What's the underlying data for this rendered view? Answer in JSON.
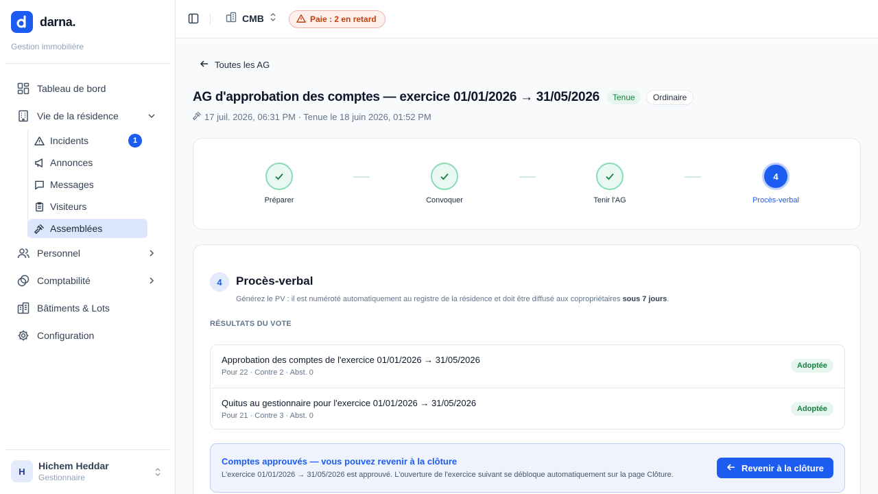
{
  "brand": {
    "name": "darna.",
    "subtitle": "Gestion immobilière",
    "accent": "#1d5cf0"
  },
  "sidebar": {
    "items": [
      {
        "label": "Tableau de bord",
        "icon": "dashboard-icon"
      },
      {
        "label": "Vie de la résidence",
        "icon": "building-icon",
        "expanded": true
      },
      {
        "label": "Personnel",
        "icon": "users-icon"
      },
      {
        "label": "Comptabilité",
        "icon": "coins-icon"
      },
      {
        "label": "Bâtiments & Lots",
        "icon": "buildings-icon"
      },
      {
        "label": "Configuration",
        "icon": "gear-icon"
      }
    ],
    "subitems": [
      {
        "label": "Incidents",
        "icon": "warning-icon",
        "badge": "1"
      },
      {
        "label": "Annonces",
        "icon": "megaphone-icon"
      },
      {
        "label": "Messages",
        "icon": "message-icon"
      },
      {
        "label": "Visiteurs",
        "icon": "clipboard-icon"
      },
      {
        "label": "Assemblées",
        "icon": "gavel-icon",
        "active": true
      }
    ]
  },
  "user": {
    "initial": "H",
    "name": "Hichem Heddar",
    "role": "Gestionnaire"
  },
  "topbar": {
    "site": "CMB",
    "alert": "Paie : 2 en retard"
  },
  "page": {
    "back_label": "Toutes les AG",
    "title": "AG d'approbation des comptes — exercice 01/01/2026 → 31/05/2026",
    "status_badge": "Tenue",
    "type_badge": "Ordinaire",
    "meta": "17 juil. 2026, 06:31 PM · Tenue le 18 juin 2026, 01:52 PM"
  },
  "stepper": {
    "steps": [
      {
        "label": "Préparer",
        "state": "done"
      },
      {
        "label": "Convoquer",
        "state": "done"
      },
      {
        "label": "Tenir l'AG",
        "state": "done"
      },
      {
        "label": "Procès-verbal",
        "state": "current",
        "number": "4"
      }
    ]
  },
  "pv": {
    "number": "4",
    "title": "Procès-verbal",
    "description": "Générez le PV : il est numéroté automatiquement au registre de la résidence et doit être diffusé aux copropriétaires ",
    "description_bold": "sous 7 jours",
    "description_end": ".",
    "results_caption": "RÉSULTATS DU VOTE",
    "results": [
      {
        "title": "Approbation des comptes de l'exercice 01/01/2026 → 31/05/2026",
        "votes": "Pour 22 · Contre 2 · Abst. 0",
        "status": "Adoptée"
      },
      {
        "title": "Quitus au gestionnaire pour l'exercice 01/01/2026 → 31/05/2026",
        "votes": "Pour 21 · Contre 3 · Abst. 0",
        "status": "Adoptée"
      }
    ],
    "notice": {
      "title": "Comptes approuvés — vous pouvez revenir à la clôture",
      "text": "L'exercice 01/01/2026 → 31/05/2026 est approuvé. L'ouverture de l'exercice suivant se débloque automatiquement sur la page Clôture.",
      "button": "Revenir à la clôture"
    }
  }
}
